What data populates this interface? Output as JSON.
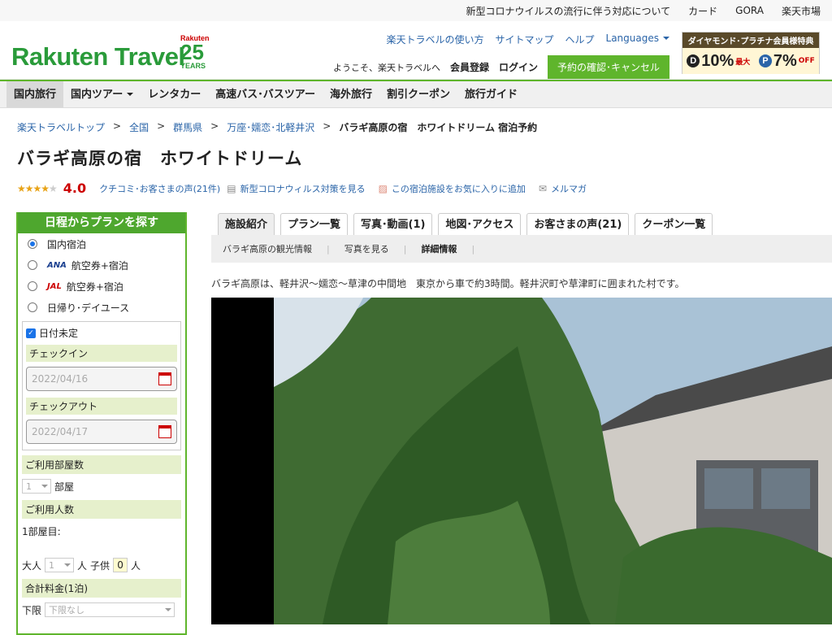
{
  "topbar": {
    "items": [
      "新型コロナウイルスの流行に伴う対応について",
      "カード",
      "GORA",
      "楽天市場"
    ]
  },
  "header": {
    "logo": "Rakuten Travel",
    "anniv_top": "Rakuten",
    "anniv_num": "25",
    "anniv_bottom": "YEARS",
    "links": [
      "楽天トラベルの使い方",
      "サイトマップ",
      "ヘルプ"
    ],
    "languages": "Languages",
    "welcome": "ようこそ、楽天トラベルへ",
    "register": "会員登録",
    "login": "ログイン",
    "reservation_btn": "予約の確認･キャンセル",
    "banner_title": "ダイヤモンド･プラチナ会員様特典",
    "banner_d": "10%",
    "banner_p": "7%",
    "banner_max": "最大",
    "banner_off": "OFF"
  },
  "nav": {
    "items": [
      "国内旅行",
      "国内ツアー",
      "レンタカー",
      "高速バス･バスツアー",
      "海外旅行",
      "割引クーポン",
      "旅行ガイド"
    ]
  },
  "breadcrumb": {
    "items": [
      "楽天トラベルトップ",
      "全国",
      "群馬県",
      "万座･嬬恋･北軽井沢"
    ],
    "current": "バラギ高原の宿　ホワイトドリーム 宿泊予約",
    "sep": ">"
  },
  "hotel": {
    "name": "バラギ高原の宿　ホワイトドリーム",
    "rating": "4.0",
    "stars_on": "★★★★",
    "stars_off": "★",
    "reviews_link": "クチコミ･お客さまの声(21件)",
    "covid_link": "新型コロナウィルス対策を見る",
    "fav_link": "この宿泊施設をお気に入りに追加",
    "mail_link": "メルマガ"
  },
  "sidebar": {
    "title": "日程からプランを探す",
    "options": [
      {
        "label": "国内宿泊",
        "airline": "",
        "selected": true
      },
      {
        "label": "航空券+宿泊",
        "airline": "ANA",
        "selected": false
      },
      {
        "label": "航空券+宿泊",
        "airline": "JAL",
        "selected": false
      },
      {
        "label": "日帰り･デイユース",
        "airline": "",
        "selected": false
      }
    ],
    "date_undecided": "日付未定",
    "checkin_label": "チェックイン",
    "checkin_value": "2022/04/16",
    "checkout_label": "チェックアウト",
    "checkout_value": "2022/04/17",
    "rooms_label": "ご利用部屋数",
    "rooms_value": "1",
    "rooms_unit": "部屋",
    "people_label": "ご利用人数",
    "room1": "1部屋目:",
    "adult_label": "大人",
    "adult_value": "1",
    "person_unit": "人",
    "child_label": "子供",
    "child_value": "0",
    "total_label": "合計料金(1泊)",
    "min_label": "下限",
    "min_value": "下限なし"
  },
  "tabs": [
    "施設紹介",
    "プラン一覧",
    "写真･動画(1)",
    "地図･アクセス",
    "お客さまの声(21)",
    "クーポン一覧"
  ],
  "subtabs": [
    "バラギ高原の観光情報",
    "写真を見る",
    "詳細情報"
  ],
  "description": "バラギ高原は、軽井沢〜嬬恋〜草津の中間地　東京から車で約3時間。軽井沢町や草津町に囲まれた村です。"
}
